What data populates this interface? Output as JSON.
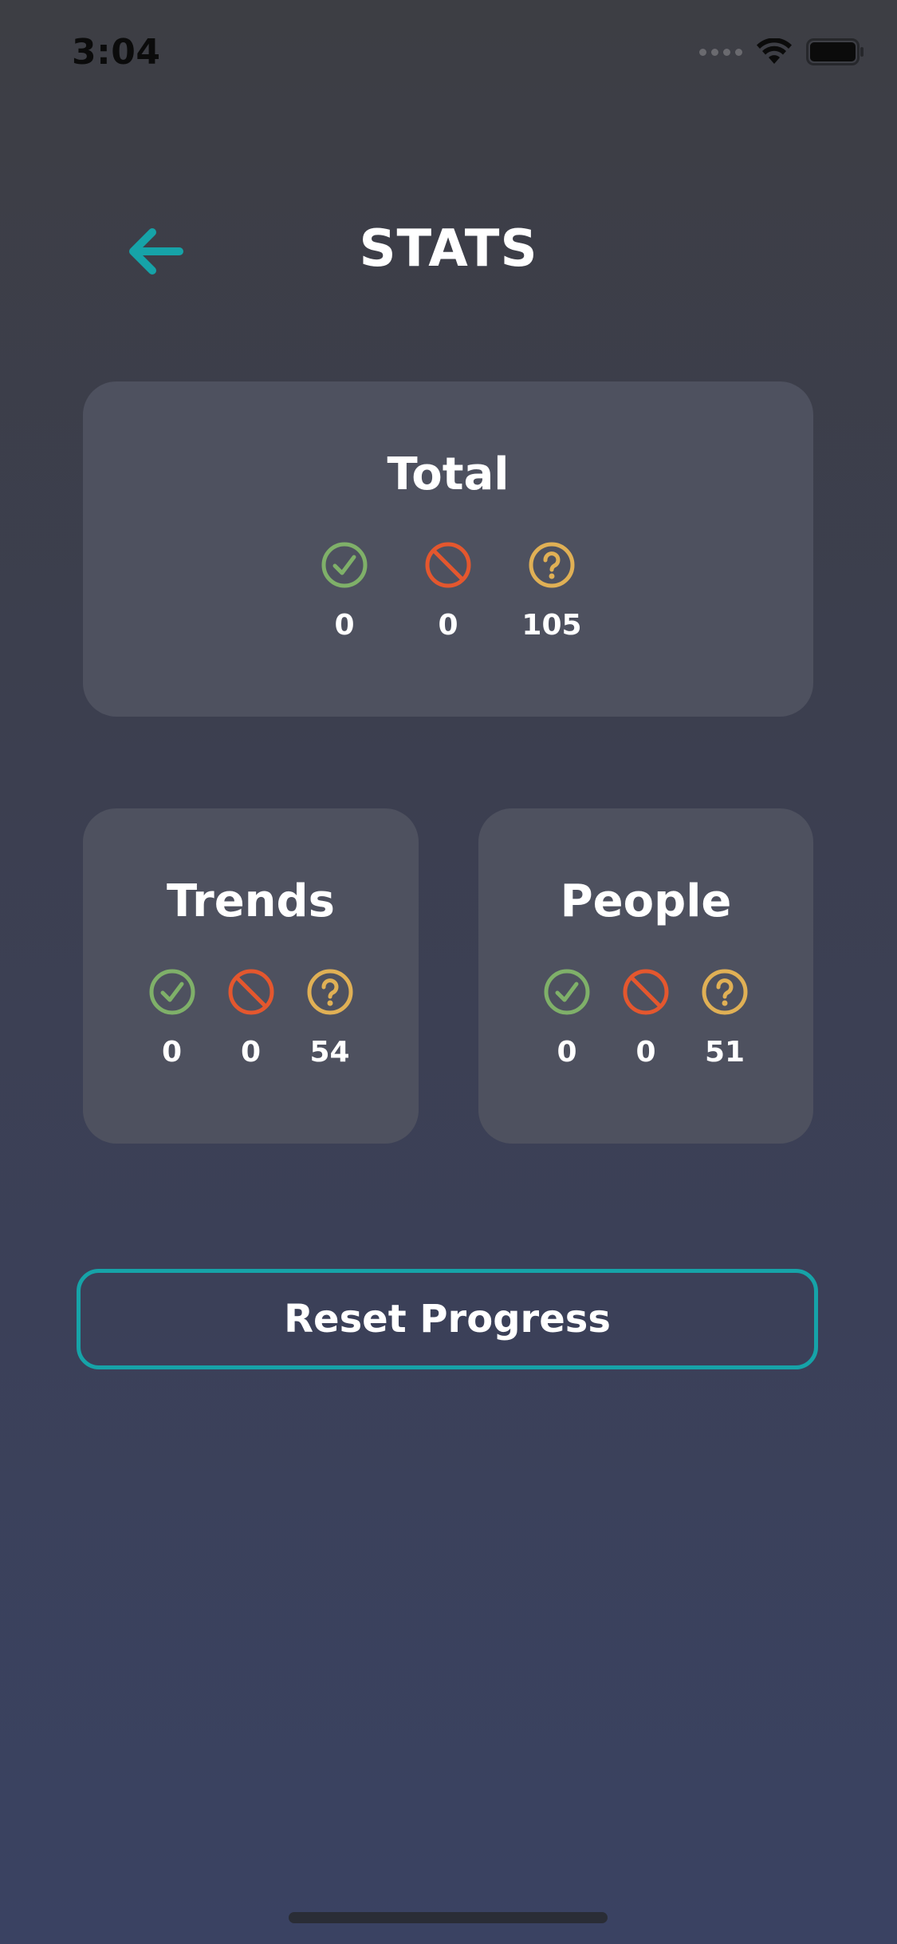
{
  "status_bar": {
    "time": "3:04",
    "wifi_icon": "wifi-icon",
    "battery_icon": "battery-icon"
  },
  "header": {
    "title": "STATS",
    "back_icon": "arrow-left-icon"
  },
  "colors": {
    "accent": "#16a3a8",
    "correct": "#7fb069",
    "wrong": "#e4572e",
    "unknown": "#e0b055",
    "card": "#4e515f"
  },
  "cards": {
    "total": {
      "title": "Total",
      "correct": "0",
      "wrong": "0",
      "unanswered": "105"
    },
    "trends": {
      "title": "Trends",
      "correct": "0",
      "wrong": "0",
      "unanswered": "54"
    },
    "people": {
      "title": "People",
      "correct": "0",
      "wrong": "0",
      "unanswered": "51"
    }
  },
  "reset_button": {
    "label": "Reset Progress"
  }
}
